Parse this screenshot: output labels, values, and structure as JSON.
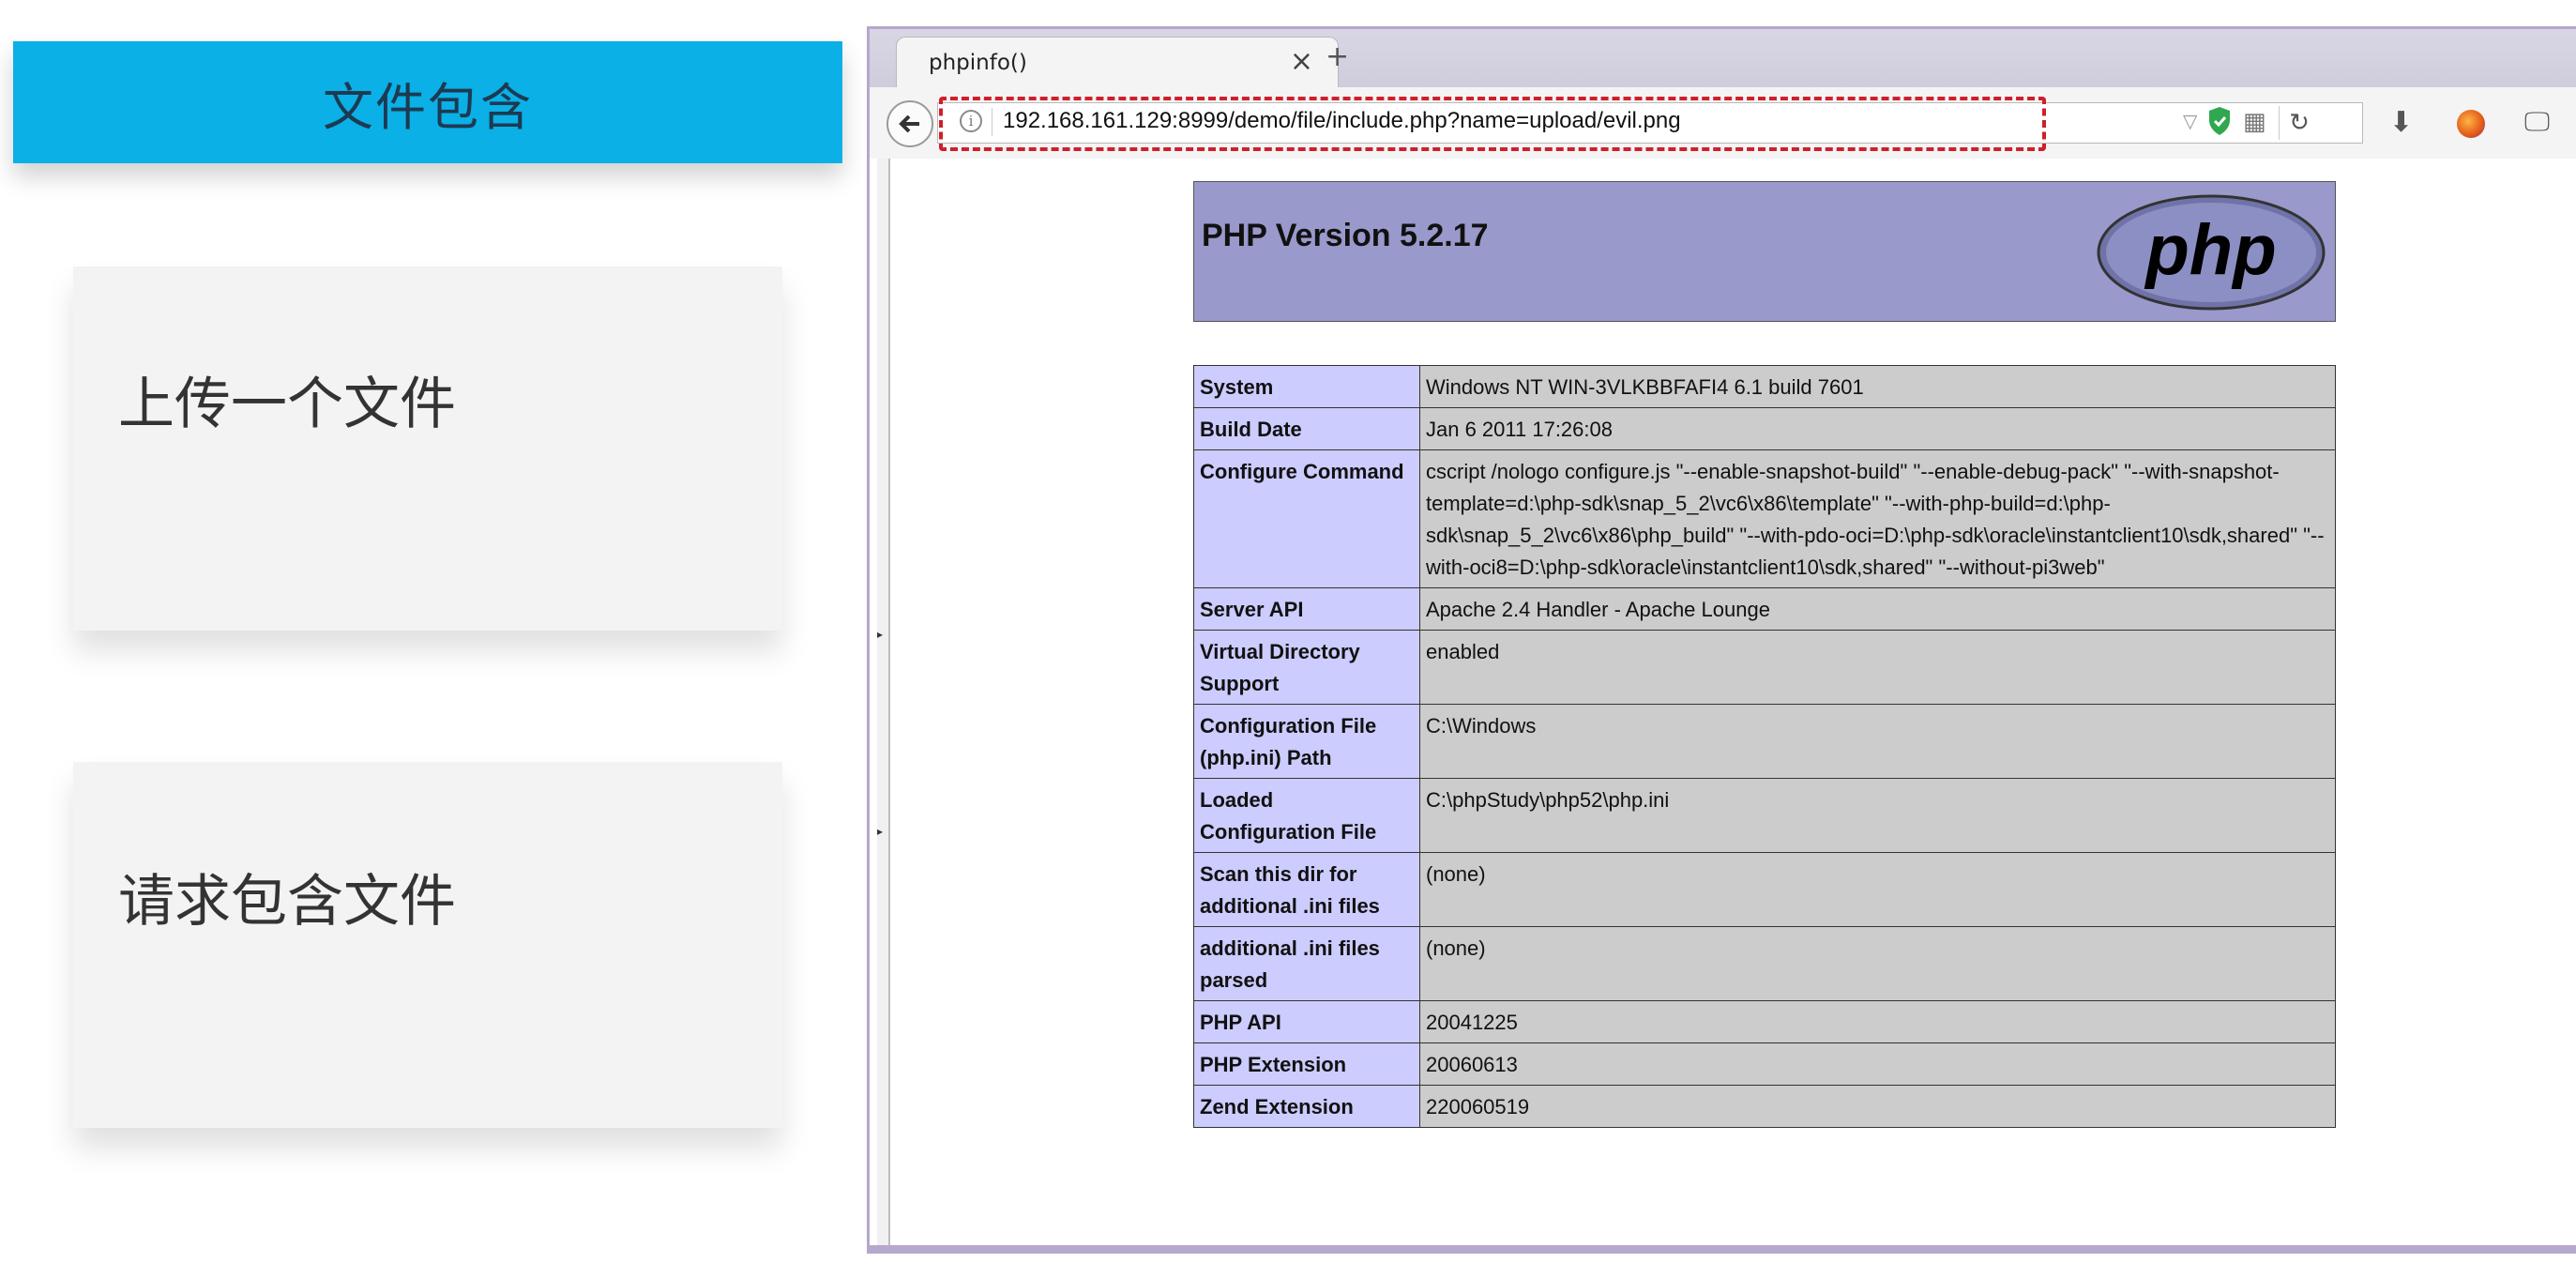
{
  "slide": {
    "header_title": "文件包含",
    "steps": [
      "上传一个文件",
      "请求包含文件"
    ],
    "colors": {
      "header_bg": "#0ab0e6",
      "card_bg": "#f3f3f3"
    }
  },
  "browser": {
    "tab_title": "phpinfo()",
    "tab_close": "×",
    "new_tab": "+",
    "back_icon": "arrow-left",
    "url": "192.168.161.129:8999/demo/file/include.php?name=upload/evil.png",
    "url_highlight_color": "#d01f2b",
    "toolbar_icons": [
      "dropdown-icon",
      "shield-icon",
      "qr-code-icon",
      "reload-icon",
      "download-icon",
      "firefox-icon",
      "screen-icon"
    ]
  },
  "phpinfo": {
    "version_title": "PHP Version 5.2.17",
    "logo_text": "php",
    "header_color": "#9999cc",
    "rows": [
      {
        "key": "System",
        "value": "Windows NT WIN-3VLKBBFAFI4 6.1 build 7601"
      },
      {
        "key": "Build Date",
        "value": "Jan 6 2011 17:26:08"
      },
      {
        "key": "Configure Command",
        "value": "cscript /nologo configure.js \"--enable-snapshot-build\" \"--enable-debug-pack\" \"--with-snapshot-template=d:\\php-sdk\\snap_5_2\\vc6\\x86\\template\" \"--with-php-build=d:\\php-sdk\\snap_5_2\\vc6\\x86\\php_build\" \"--with-pdo-oci=D:\\php-sdk\\oracle\\instantclient10\\sdk,shared\" \"--with-oci8=D:\\php-sdk\\oracle\\instantclient10\\sdk,shared\" \"--without-pi3web\""
      },
      {
        "key": "Server API",
        "value": "Apache 2.4 Handler - Apache Lounge"
      },
      {
        "key": "Virtual Directory Support",
        "value": "enabled"
      },
      {
        "key": "Configuration File (php.ini) Path",
        "value": "C:\\Windows"
      },
      {
        "key": "Loaded Configuration File",
        "value": "C:\\phpStudy\\php52\\php.ini"
      },
      {
        "key": "Scan this dir for additional .ini files",
        "value": "(none)"
      },
      {
        "key": "additional .ini files parsed",
        "value": "(none)"
      },
      {
        "key": "PHP API",
        "value": "20041225"
      },
      {
        "key": "PHP Extension",
        "value": "20060613"
      },
      {
        "key": "Zend Extension",
        "value": "220060519"
      }
    ]
  }
}
